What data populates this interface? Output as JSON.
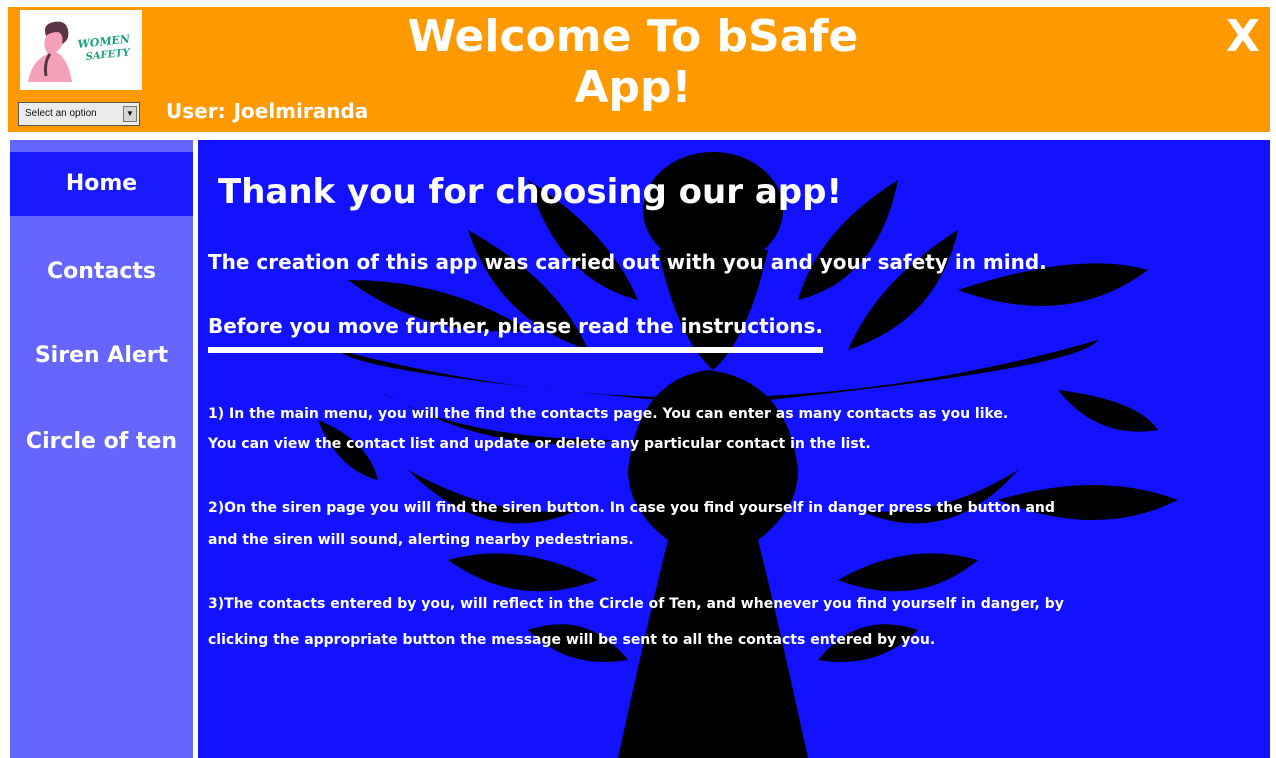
{
  "header": {
    "title": "Welcome To bSafe App!",
    "close_label": "X",
    "logo_text": "WOMEN SAFETY",
    "select_value": "Select an option",
    "user_label": "User:",
    "user_name": "Joelmiranda"
  },
  "sidebar": {
    "items": [
      {
        "label": "Home",
        "active": true
      },
      {
        "label": "Contacts",
        "active": false
      },
      {
        "label": "Siren Alert",
        "active": false
      },
      {
        "label": "Circle of ten",
        "active": false
      }
    ]
  },
  "main": {
    "heading": "Thank you for choosing our app!",
    "intro": "The creation of this app was carried out with you and your safety in mind.",
    "instructions_heading": "Before you move further, please read the instructions.",
    "instructions": [
      {
        "line1": "1) In the main menu, you will the find the contacts page.  You can enter as many contacts as you like.",
        "line2": "You can view the contact list and update or delete any particular contact in the list."
      },
      {
        "line1": "2)On the siren page you will find the siren button.   In case you find yourself in danger press the button and",
        "line2": "and the siren will sound, alerting nearby pedestrians."
      },
      {
        "line1": "3)The contacts entered by you, will reflect in the Circle of Ten, and whenever you find yourself in danger, by",
        "line2": "clicking the appropriate button the message will be sent to all the contacts entered by you."
      }
    ]
  },
  "colors": {
    "header_bg": "#ff9900",
    "sidebar_bg": "#6666ff",
    "sidebar_active": "#1a1aff",
    "main_bg": "#1212ff",
    "text": "#ffffff"
  },
  "icons": {
    "logo": "woman-silhouette-logo-icon",
    "watermark": "flower-woman-silhouette-icon",
    "dropdown": "dropdown-arrow-icon"
  }
}
